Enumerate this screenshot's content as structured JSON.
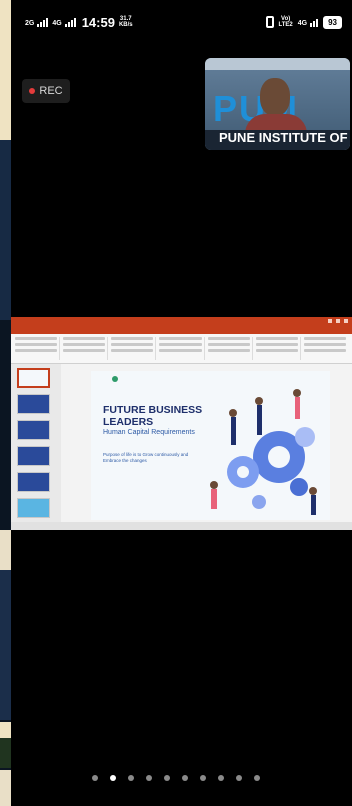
{
  "status_bar": {
    "net1_top": "2G",
    "net2_top": "4G",
    "time": "14:59",
    "speed_value": "31.7",
    "speed_unit": "KB/s",
    "volte_top": "Vo)",
    "volte_bottom": "LTE2",
    "net3_top": "4G",
    "battery": "93"
  },
  "recording": {
    "label": "REC"
  },
  "video_tile": {
    "banner_text": "PUM",
    "sub_text": "PUNE INSTITUTE OF"
  },
  "shared_screen": {
    "slide": {
      "title": "FUTURE BUSINESS LEADERS",
      "subtitle": "Human Capital Requirements",
      "body": "Purpose of life is to Grow continuously and Embrace the changes"
    }
  },
  "pager": {
    "count": 10,
    "active_index": 1
  },
  "colors": {
    "ppt_accent": "#c43e1c",
    "slide_title": "#1e2f6b",
    "rec_dot": "#e43b3b"
  }
}
